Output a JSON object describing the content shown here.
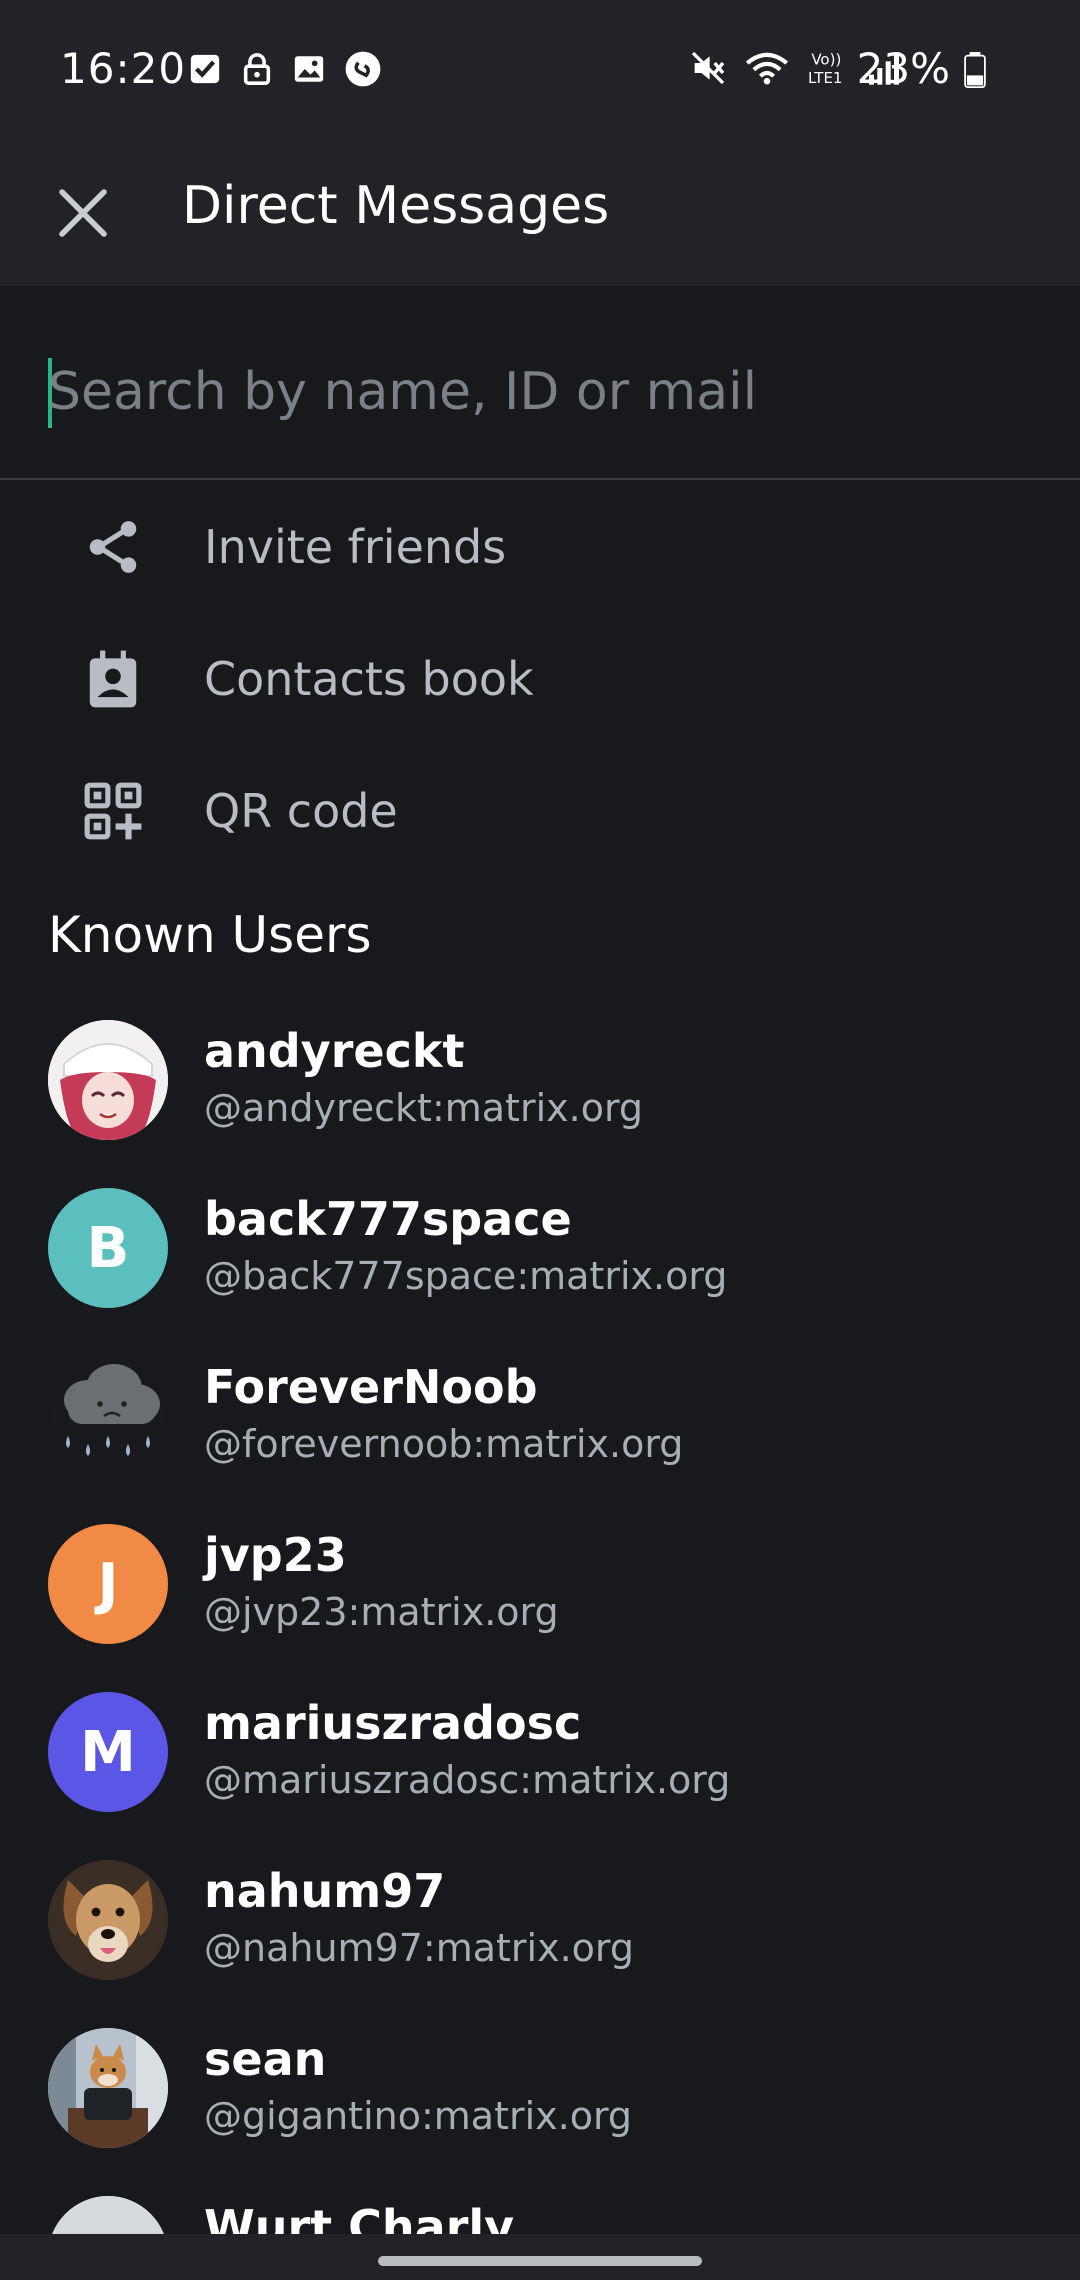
{
  "status_bar": {
    "time": "16:20",
    "battery": "23%",
    "icons_left": [
      "checkbox-icon",
      "lock-icon",
      "image-icon",
      "shazam-icon"
    ],
    "icons_right": [
      "mute-icon",
      "wifi-icon",
      "volte-icon",
      "signal-icon"
    ]
  },
  "app_bar": {
    "title": "Direct Messages",
    "close_icon": "close-icon"
  },
  "search": {
    "placeholder": "Search by name, ID or mail",
    "value": ""
  },
  "actions": [
    {
      "label": "Invite friends",
      "icon": "share-icon"
    },
    {
      "label": "Contacts book",
      "icon": "contact-book-icon"
    },
    {
      "label": "QR code",
      "icon": "qr-code-icon"
    }
  ],
  "known_users": {
    "title": "Known Users",
    "users": [
      {
        "name": "andyreckt",
        "id": "@andyreckt:matrix.org",
        "avatar_type": "image",
        "avatar_letter": ""
      },
      {
        "name": "back777space",
        "id": "@back777space:matrix.org",
        "avatar_type": "letter",
        "avatar_letter": "B",
        "avatar_color": "#5bbfbd"
      },
      {
        "name": "ForeverNoob",
        "id": "@forevernoob:matrix.org",
        "avatar_type": "image",
        "avatar_letter": ""
      },
      {
        "name": "jvp23",
        "id": "@jvp23:matrix.org",
        "avatar_type": "letter",
        "avatar_letter": "J",
        "avatar_color": "#f08a44"
      },
      {
        "name": "mariuszradosc",
        "id": "@mariuszradosc:matrix.org",
        "avatar_type": "letter",
        "avatar_letter": "M",
        "avatar_color": "#5b57e6"
      },
      {
        "name": "nahum97",
        "id": "@nahum97:matrix.org",
        "avatar_type": "image",
        "avatar_letter": ""
      },
      {
        "name": "sean",
        "id": "@gigantino:matrix.org",
        "avatar_type": "image",
        "avatar_letter": ""
      },
      {
        "name": "Wurt Charly",
        "id": "",
        "avatar_type": "image",
        "avatar_letter": ""
      }
    ]
  },
  "colors": {
    "background": "#17191c",
    "bar": "#212327",
    "accent": "#2fb383",
    "secondary_text": "#a9adb4"
  }
}
